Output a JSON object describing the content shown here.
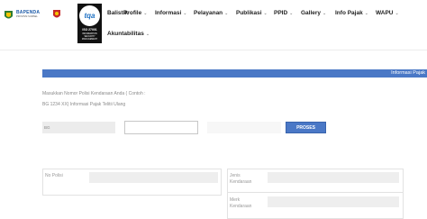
{
  "header": {
    "logo": {
      "title": "BAPENDA",
      "subtitle": "PROVINSI SUMSEL"
    },
    "cert": {
      "brand": "tqa",
      "standard": "ISO 27001",
      "caption": "INFORMATION SECURITY MANAGEMENT"
    },
    "nav": [
      {
        "label": "Balistik"
      },
      {
        "label": "Profile"
      },
      {
        "label": "Informasi"
      },
      {
        "label": "Pelayanan"
      },
      {
        "label": "Publikasi"
      },
      {
        "label": "PPID"
      },
      {
        "label": "Gallery"
      },
      {
        "label": "Info Pajak"
      },
      {
        "label": "WAPU"
      },
      {
        "label": "Akuntabilitas"
      }
    ]
  },
  "section_title": "Informasi Pajak",
  "hint": {
    "line1": "Masukkan Nomor Polisi Kendaraan Anda ( Contoh :",
    "line2": "BG 1234 XX) Informasi Pajak Telitii Ulang"
  },
  "form": {
    "prefix_value": "BG",
    "number_value": "",
    "suffix_value": "",
    "submit_label": "PROSES"
  },
  "result": {
    "left_label": "No Polisi",
    "right_labels": [
      "Jenis Kendaraan",
      "Merk Kendaraan"
    ]
  },
  "colors": {
    "accent": "#4a78c6",
    "field_bg": "#ececec"
  }
}
